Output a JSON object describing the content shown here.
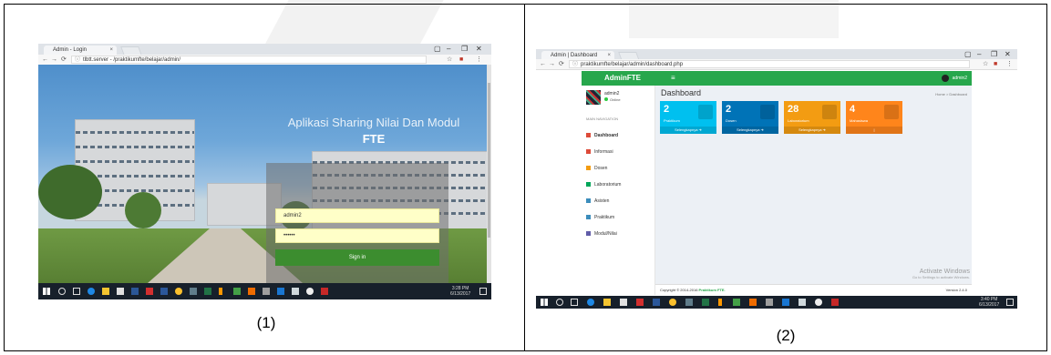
{
  "captions": {
    "left": "(1)",
    "right": "(2)"
  },
  "screenshot1": {
    "tab_title": "Admin - Login",
    "url": "tlbtt.server - /praktikumfte/belajar/admin/",
    "hero_title": "Aplikasi Sharing Nilai Dan Modul",
    "hero_subtitle": "FTE",
    "username_value": "admin2",
    "password_value": "••••••",
    "submit_label": "Sign in",
    "logo_letter": "U",
    "clock": {
      "time": "3:28 PM",
      "date": "6/13/2017"
    }
  },
  "screenshot2": {
    "tab_title": "Admin | Dashboard",
    "url": "praktikumfte/belajar/admin/dashboard.php",
    "brand": "AdminFTE",
    "menu_glyph": "≡",
    "admin_name": "admin2",
    "user": {
      "name": "admin2",
      "status": "Online"
    },
    "nav_header": "MAIN NAVIGATION",
    "nav_items": [
      {
        "label": "Dashboard",
        "color": "#dd4b39"
      },
      {
        "label": "Informasi",
        "color": "#dd4b39"
      },
      {
        "label": "Dosen",
        "color": "#f39c12"
      },
      {
        "label": "Laboratorium",
        "color": "#00a65a"
      },
      {
        "label": "Asisten",
        "color": "#3c8dbc"
      },
      {
        "label": "Praktikum",
        "color": "#3c8dbc"
      },
      {
        "label": "Modul/Nilai",
        "color": "#605ca8"
      }
    ],
    "page_title": "Dashboard",
    "breadcrumb": "Home > Dashboard",
    "boxes": [
      {
        "value": "2",
        "label": "Praktikum",
        "more": "Selengkapnya",
        "color": "#00c0ef"
      },
      {
        "value": "2",
        "label": "Dosen",
        "more": "Selengkapnya",
        "color": "#0073b7"
      },
      {
        "value": "28",
        "label": "Laboratorium",
        "more": "Selengkapnya",
        "color": "#f39c12"
      },
      {
        "value": "4",
        "label": "Mahasiswa",
        "more": "",
        "color": "#ff851b"
      }
    ],
    "footer_copyright": "Copyright © 2014-2016",
    "footer_brand": "Praktikum FTE.",
    "version": "Version 2.4.0",
    "activate_title": "Activate Windows",
    "activate_sub": "Go to Settings to activate Windows.",
    "clock": {
      "time": "3:40 PM",
      "date": "6/13/2017"
    }
  }
}
